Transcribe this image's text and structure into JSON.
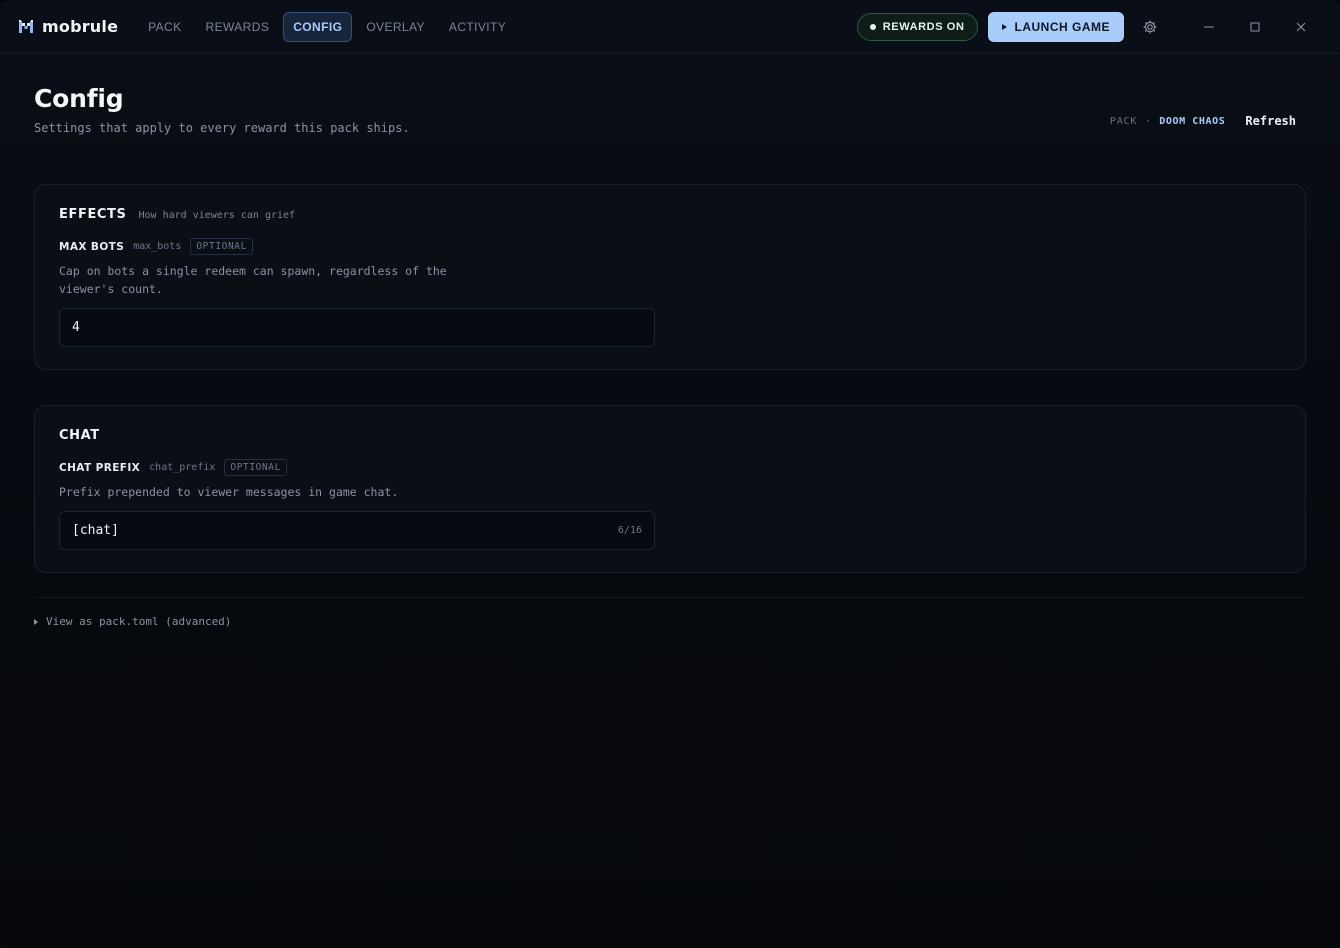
{
  "app": {
    "name": "mobrule"
  },
  "nav": {
    "tabs": [
      {
        "label": "PACK"
      },
      {
        "label": "REWARDS"
      },
      {
        "label": "CONFIG"
      },
      {
        "label": "OVERLAY"
      },
      {
        "label": "ACTIVITY"
      }
    ],
    "active": "CONFIG"
  },
  "toolbar": {
    "rewards_status": "REWARDS ON",
    "launch_label": "LAUNCH GAME"
  },
  "page": {
    "title": "Config",
    "subtitle": "Settings that apply to every reward this pack ships.",
    "pack_label": "PACK",
    "pack_separator": "·",
    "pack_name": "DOOM CHAOS",
    "refresh_label": "Refresh"
  },
  "sections": [
    {
      "title": "EFFECTS",
      "hint": "How hard viewers can grief",
      "field": {
        "label": "MAX BOTS",
        "key": "max_bots",
        "badge": "OPTIONAL",
        "description": "Cap on bots a single redeem can spawn, regardless of the viewer's count.",
        "value": "4"
      }
    },
    {
      "title": "CHAT",
      "field": {
        "label": "CHAT PREFIX",
        "key": "chat_prefix",
        "badge": "OPTIONAL",
        "description": "Prefix prepended to viewer messages in game chat.",
        "value": "[chat]",
        "counter": "6/16"
      }
    }
  ],
  "advanced": {
    "label": "View as pack.toml (advanced)"
  },
  "colors": {
    "accent": "#a9cdfb",
    "active_tab_text": "#a9ccff",
    "status_border": "#2a5a44",
    "background": "#06080d"
  }
}
